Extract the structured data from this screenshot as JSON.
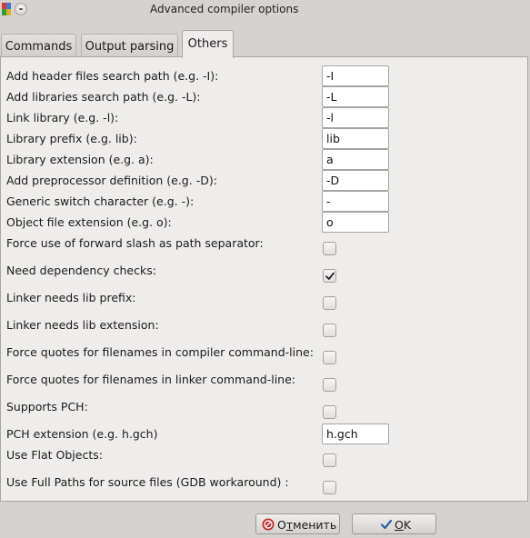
{
  "window": {
    "title": "Advanced compiler options"
  },
  "tabs": [
    {
      "label": "Commands"
    },
    {
      "label": "Output parsing"
    },
    {
      "label": "Others"
    }
  ],
  "text_fields": [
    {
      "label": "Add header files search path (e.g. -I):",
      "value": "-I"
    },
    {
      "label": "Add libraries search path (e.g. -L):",
      "value": "-L"
    },
    {
      "label": "Link library (e.g. -l):",
      "value": "-l"
    },
    {
      "label": "Library prefix (e.g. lib):",
      "value": "lib"
    },
    {
      "label": "Library extension (e.g. a):",
      "value": "a"
    },
    {
      "label": "Add preprocessor definition (e.g. -D):",
      "value": "-D"
    },
    {
      "label": "Generic switch character (e.g. -):",
      "value": "-"
    },
    {
      "label": "Object file extension (e.g. o):",
      "value": "o"
    }
  ],
  "options": [
    {
      "label": "Force use of forward slash as path separator:",
      "checked": false
    },
    {
      "label": "Need dependency checks:",
      "checked": true
    },
    {
      "label": "Linker needs lib prefix:",
      "checked": false
    },
    {
      "label": "Linker needs lib extension:",
      "checked": false
    },
    {
      "label": "Force quotes for filenames in compiler command-line:",
      "checked": false
    },
    {
      "label": "Force quotes for filenames in linker command-line:",
      "checked": false
    },
    {
      "label": "Supports PCH:",
      "checked": false
    }
  ],
  "pch_extension": {
    "label": "PCH extension (e.g. h.gch)",
    "value": "h.gch"
  },
  "extra_options": [
    {
      "label": "Use Flat Objects:",
      "checked": false
    },
    {
      "label": "Use Full Paths for source files (GDB workaround) :",
      "checked": false
    }
  ],
  "buttons": {
    "cancel": {
      "label": "Отменить",
      "mnemonic_index": 1
    },
    "ok": {
      "label": "OK",
      "mnemonic_index": 0
    }
  },
  "colors": {
    "cancel_icon": "#c62828",
    "ok_check": "#2d5fa8"
  }
}
